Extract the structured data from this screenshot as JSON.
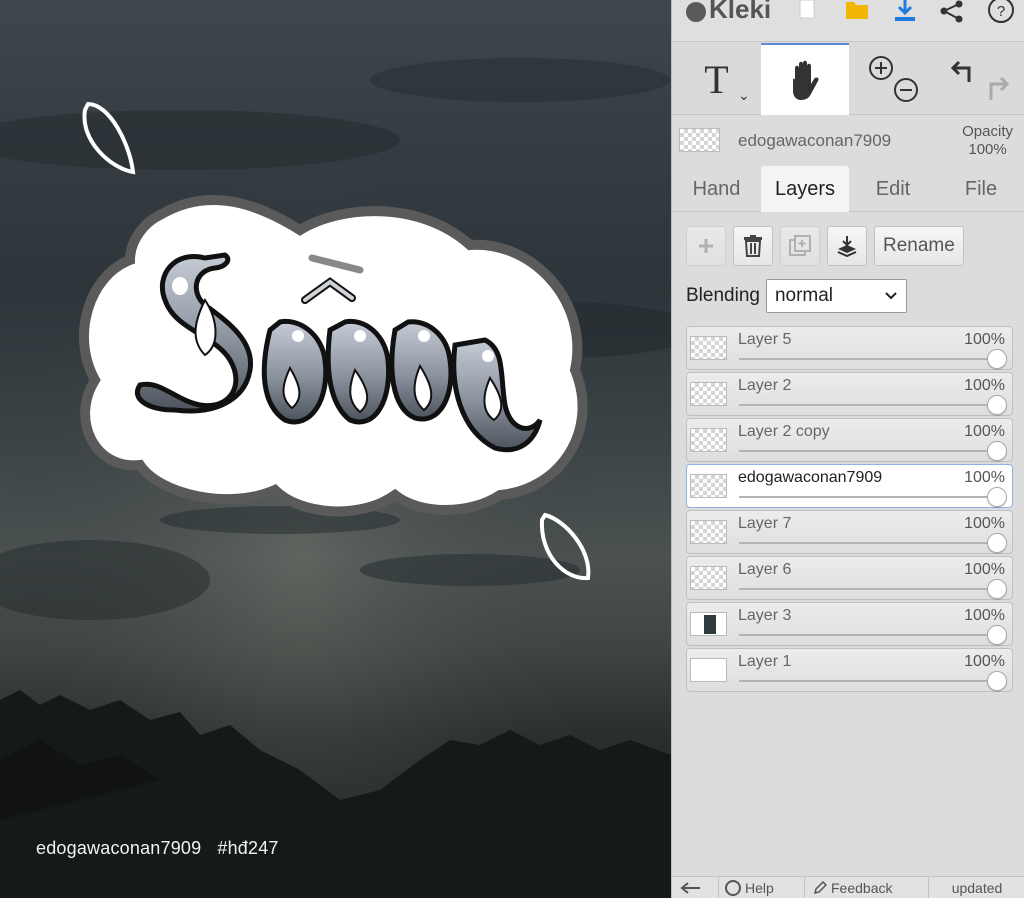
{
  "app": {
    "brand": "Kleki"
  },
  "topbar": {
    "icons": [
      "kleki-logo-icon",
      "new-file-icon",
      "open-folder-icon",
      "download-icon",
      "share-icon",
      "help-icon"
    ]
  },
  "tools": {
    "text_icon": "T",
    "items": [
      "text-tool-icon",
      "hand-tool-icon",
      "zoom-in-icon",
      "zoom-out-icon",
      "undo-icon",
      "redo-icon"
    ],
    "active": "hand"
  },
  "current_layer": {
    "name": "edogawaconan7909",
    "opacity_label": "Opacity",
    "opacity_value": "100%"
  },
  "tabs": [
    {
      "label": "Hand"
    },
    {
      "label": "Layers",
      "active": true
    },
    {
      "label": "Edit"
    },
    {
      "label": "File"
    }
  ],
  "layer_actions": {
    "buttons": [
      "add-layer-icon",
      "delete-layer-icon",
      "duplicate-layer-icon",
      "merge-down-icon"
    ],
    "rename_label": "Rename"
  },
  "blending": {
    "label": "Blending",
    "value": "normal"
  },
  "layers": [
    {
      "name": "Layer 5",
      "opacity": "100%"
    },
    {
      "name": "Layer 2",
      "opacity": "100%"
    },
    {
      "name": "Layer 2 copy",
      "opacity": "100%"
    },
    {
      "name": "edogawaconan7909",
      "opacity": "100%",
      "active": true
    },
    {
      "name": "Layer 7",
      "opacity": "100%"
    },
    {
      "name": "Layer 6",
      "opacity": "100%"
    },
    {
      "name": "Layer 3",
      "opacity": "100%"
    },
    {
      "name": "Layer 1",
      "opacity": "100%"
    }
  ],
  "canvas": {
    "watermark_name": "edogawaconan7909",
    "watermark_tag": "#hđ247"
  },
  "bottombar": {
    "help_label": "Help",
    "feedback_label": "Feedback",
    "updated_label": "updated"
  },
  "colors": {
    "accent": "#5f8bd6",
    "download": "#1e7be0",
    "folder": "#f2b705"
  }
}
